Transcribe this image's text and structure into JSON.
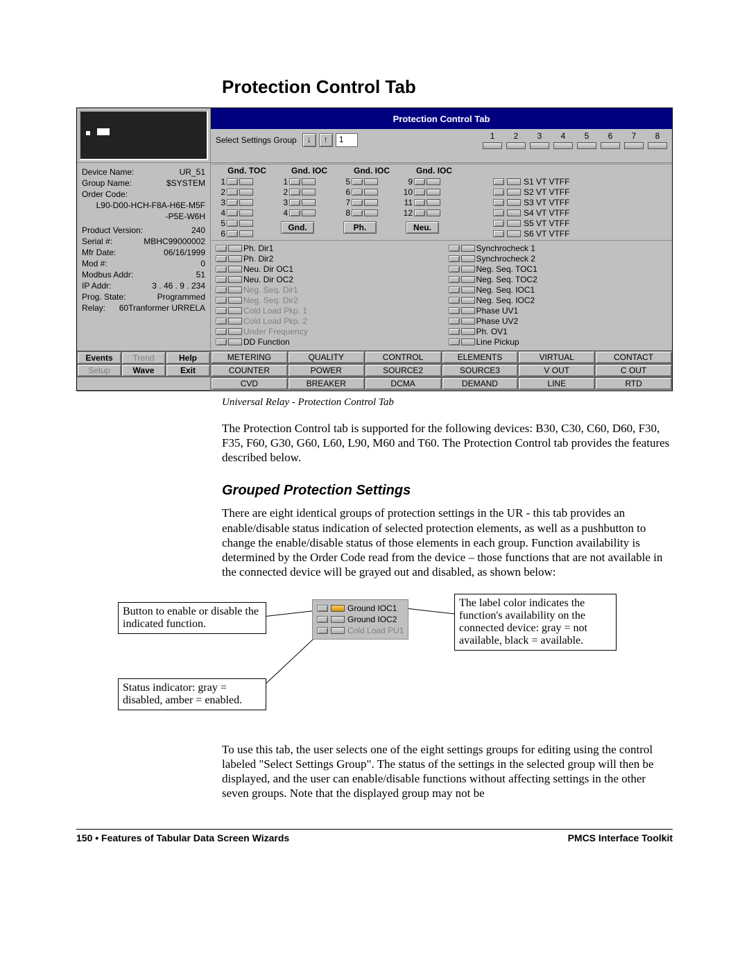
{
  "title": "Protection Control Tab",
  "caption": "Universal Relay - Protection Control Tab",
  "panel": {
    "titlebar": "Protection Control Tab",
    "select_group_label": "Select Settings Group",
    "group_index": "1",
    "group_numbers": [
      "1",
      "2",
      "3",
      "4",
      "5",
      "6",
      "7",
      "8"
    ],
    "col_headers": [
      "Gnd. TOC",
      "Gnd. IOC",
      "Gnd. IOC",
      "Gnd. IOC"
    ],
    "mid_buttons": [
      "Gnd.",
      "Ph.",
      "Neu."
    ],
    "vt_rows": [
      "S1 VT VTFF",
      "S2 VT VTFF",
      "S3 VT VTFF",
      "S4 VT VTFF",
      "S5 VT VTFF",
      "S6 VT VTFF"
    ],
    "info": {
      "device_name_label": "Device Name:",
      "device_name": "UR_51",
      "group_name_label": "Group Name:",
      "group_name": "$SYSTEM",
      "order_code_label": "Order Code:",
      "order_code1": "L90-D00-HCH-F8A-H6E-M5F",
      "order_code2": "-P5E-W6H",
      "prod_ver_label": "Product Version:",
      "prod_ver": "240",
      "serial_label": "Serial #:",
      "serial": "MBHC99000002",
      "mfr_label": "Mfr Date:",
      "mfr": "06/16/1999",
      "mod_label": "Mod #:",
      "mod": "0",
      "addr_label": "Modbus Addr:",
      "addr": "51",
      "ip_label": "IP Addr:",
      "ip": "3 .  46 .    9 . 234",
      "prog_label": "Prog. State:",
      "prog": "Programmed",
      "relay_label": "Relay:",
      "relay": "60Tranformer URRELA"
    },
    "nav_buttons": {
      "events": "Events",
      "trend": "Trend",
      "help": "Help",
      "setup": "Setup",
      "wave": "Wave",
      "exit": "Exit"
    },
    "list_left": [
      {
        "t": "Ph. Dir1",
        "g": false
      },
      {
        "t": "Ph. Dir2",
        "g": false
      },
      {
        "t": "Neu. Dir OC1",
        "g": false
      },
      {
        "t": "Neu. Dir OC2",
        "g": false
      },
      {
        "t": "Neg. Seq. Dir1",
        "g": true
      },
      {
        "t": "Neg. Seq. Dir2",
        "g": true
      },
      {
        "t": "Cold Load Pkp. 1",
        "g": true
      },
      {
        "t": "Cold Load Pkp. 2",
        "g": true
      },
      {
        "t": "Under Frequency",
        "g": true
      },
      {
        "t": "DD Function",
        "g": false
      }
    ],
    "list_right": [
      {
        "t": "Synchrocheck 1",
        "g": false
      },
      {
        "t": "Synchrocheck 2",
        "g": false
      },
      {
        "t": "Neg. Seq. TOC1",
        "g": false
      },
      {
        "t": "Neg. Seq. TOC2",
        "g": false
      },
      {
        "t": "Neg. Seq. IOC1",
        "g": false
      },
      {
        "t": "Neg. Seq. IOC2",
        "g": false
      },
      {
        "t": "Phase UV1",
        "g": false
      },
      {
        "t": "Phase UV2",
        "g": false
      },
      {
        "t": "Ph. OV1",
        "g": false
      },
      {
        "t": "Line Pickup",
        "g": false
      }
    ],
    "tabs_row1": [
      "METERING",
      "QUALITY",
      "CONTROL",
      "ELEMENTS",
      "VIRTUAL",
      "CONTACT"
    ],
    "tabs_row2": [
      "COUNTER",
      "POWER",
      "SOURCE2",
      "SOURCE3",
      "V OUT",
      "C OUT"
    ],
    "tabs_row3": [
      "CVD",
      "BREAKER",
      "DCMA",
      "DEMAND",
      "LINE",
      "RTD"
    ]
  },
  "para1": "The Protection Control tab is supported for the following devices: B30, C30, C60, D60, F30, F35, F60, G30, G60, L60, L90, M60 and T60.  The Protection Control tab provides the features described below.",
  "subhead": "Grouped Protection Settings",
  "para2": "There are eight identical groups of protection settings in the UR - this tab provides an enable/disable status indication of selected protection elements, as well as a pushbutton to change the enable/disable status of those elements in each group. Function availability is determined by the Order Code read from the device – those functions that are not available in the connected device will be grayed out and disabled, as shown below:",
  "note_left": "Button to enable or disable the indicated function.",
  "note_right": "The label color indicates  the function's availability on the connected device: gray = not available, black = available.",
  "note_bottom": "Status indicator: gray = disabled, amber = enabled.",
  "snippet": [
    "Ground IOC1",
    "Ground IOC2",
    "Cold Load PU1"
  ],
  "para3": "To use this tab, the user selects one of the eight settings groups for editing using the control labeled \"Select Settings Group\". The status of the settings in the selected group will then be displayed, and the user can enable/disable functions without affecting settings in the other seven groups. Note that the displayed group may not be",
  "footer_left": "150  •  Features of Tabular Data Screen Wizards",
  "footer_right": "PMCS Interface Toolkit"
}
